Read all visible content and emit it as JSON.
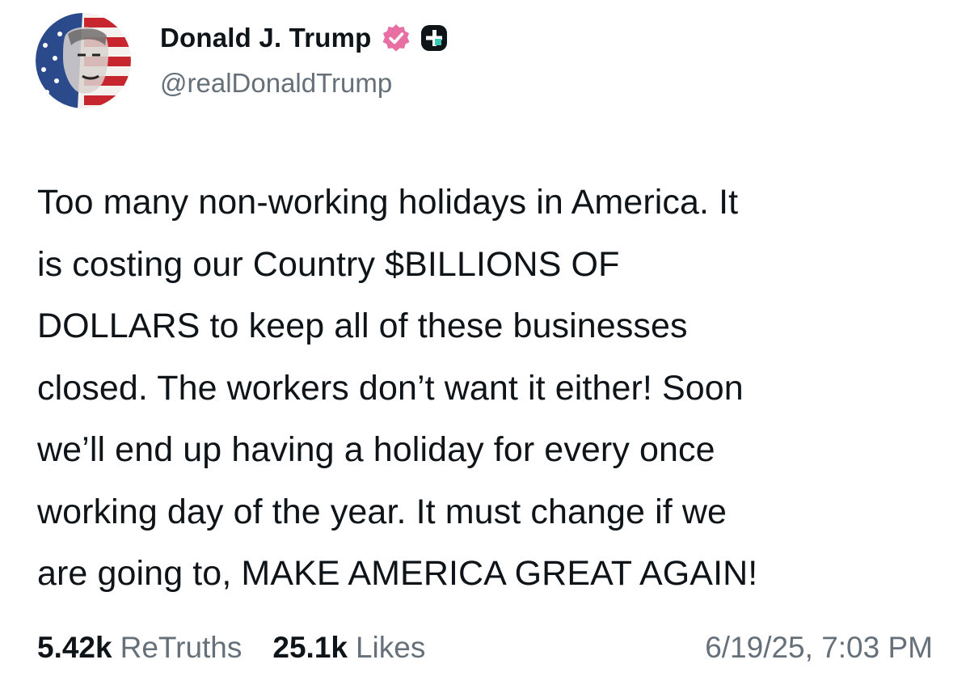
{
  "author": {
    "display_name": "Donald J. Trump",
    "handle": "@realDonaldTrump",
    "avatar_icon": "avatar-flag-portrait",
    "verified_icon": "verified-badge-icon",
    "verified_color": "#e86fa3",
    "plus_badge_icon": "plus-badge-icon"
  },
  "post": {
    "text": "Too many non-working holidays in America. It\nis costing our Country $BILLIONS OF\nDOLLARS to keep all of these businesses\nclosed. The workers don’t want it either! Soon\nwe’ll end up having a holiday for every once\nworking day of the year. It must change if we\nare going to, MAKE AMERICA GREAT AGAIN!"
  },
  "stats": {
    "retruths_count": "5.42k",
    "retruths_label": "ReTruths",
    "likes_count": "25.1k",
    "likes_label": "Likes"
  },
  "timestamp": "6/19/25, 7:03 PM",
  "colors": {
    "text_primary": "#0f1419",
    "text_secondary": "#66707a",
    "background": "#ffffff"
  }
}
